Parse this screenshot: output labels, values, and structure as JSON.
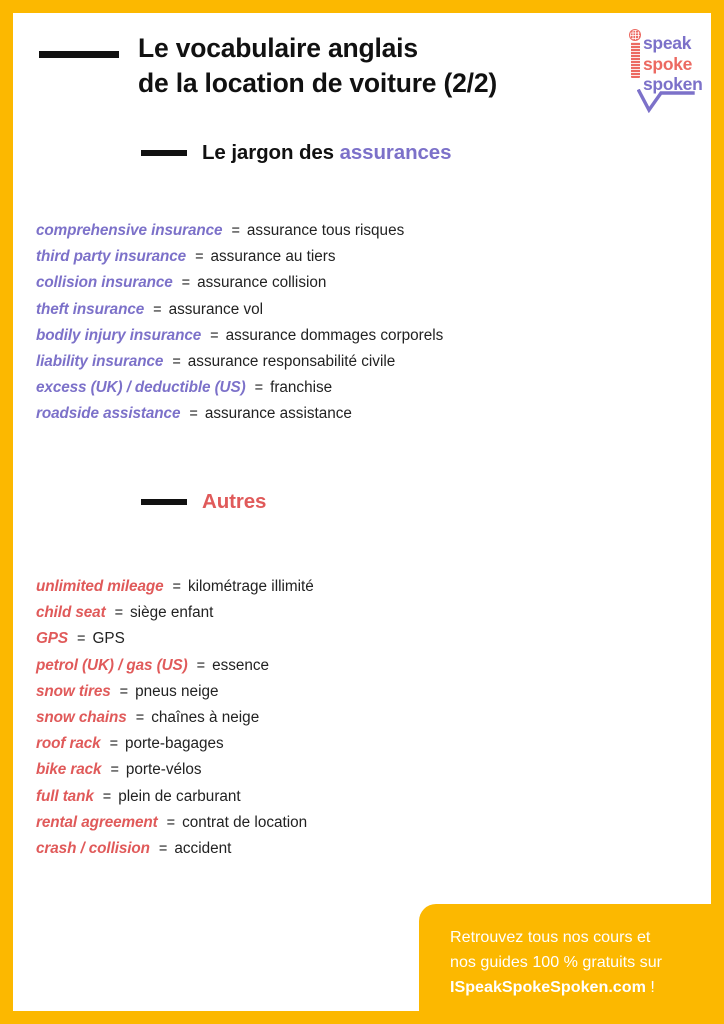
{
  "colors": {
    "frame": "#FCB800",
    "purple": "#7C71C9",
    "red": "#E05A5A",
    "black": "#111111",
    "white": "#FFFFFF"
  },
  "header": {
    "title_line1": "Le vocabulaire anglais",
    "title_line2": "de la location de voiture (2/2)"
  },
  "logo": {
    "word1": "speak",
    "word2": "spoke",
    "word3": "spoken",
    "i_letter": "i",
    "check": "check-swoosh"
  },
  "sections": [
    {
      "id": "assurances",
      "heading_plain": "Le jargon des ",
      "heading_accent": "assurances",
      "accent_color": "#7C71C9",
      "entries": [
        {
          "en": "comprehensive insurance",
          "eq": "=",
          "fr": "assurance tous risques"
        },
        {
          "en": "third party insurance",
          "eq": "=",
          "fr": "assurance au tiers"
        },
        {
          "en": "collision insurance",
          "eq": "=",
          "fr": "assurance collision"
        },
        {
          "en": "theft insurance",
          "eq": "=",
          "fr": "assurance vol"
        },
        {
          "en": "bodily injury insurance",
          "eq": "=",
          "fr": "assurance dommages corporels"
        },
        {
          "en": "liability insurance",
          "eq": "=",
          "fr": "assurance responsabilité civile"
        },
        {
          "en": "excess (UK) / deductible (US)",
          "eq": "=",
          "fr": "franchise"
        },
        {
          "en": "roadside assistance",
          "eq": "=",
          "fr": "assurance assistance"
        }
      ]
    },
    {
      "id": "autres",
      "heading_plain": "",
      "heading_accent": "Autres",
      "accent_color": "#E05A5A",
      "entries": [
        {
          "en": "unlimited mileage",
          "eq": "=",
          "fr": "kilométrage illimité"
        },
        {
          "en": "child seat",
          "eq": "=",
          "fr": "siège enfant"
        },
        {
          "en": "GPS",
          "eq": "=",
          "fr": "GPS"
        },
        {
          "en": "petrol (UK) / gas (US)",
          "eq": "=",
          "fr": "essence"
        },
        {
          "en": "snow tires",
          "eq": "=",
          "fr": "pneus neige"
        },
        {
          "en": "snow chains",
          "eq": "=",
          "fr": "chaînes à neige"
        },
        {
          "en": "roof rack",
          "eq": "=",
          "fr": "porte-bagages"
        },
        {
          "en": "bike rack",
          "eq": "=",
          "fr": "porte-vélos"
        },
        {
          "en": "full tank",
          "eq": "=",
          "fr": "plein de carburant"
        },
        {
          "en": "rental agreement",
          "eq": "=",
          "fr": "contrat de location"
        },
        {
          "en": "crash / collision",
          "eq": "=",
          "fr": "accident"
        }
      ]
    }
  ],
  "footer": {
    "line1": "Retrouvez tous nos cours et",
    "line2": "nos guides 100 % gratuits sur",
    "line3_strong": "ISpeakSpokeSpoken.com",
    "line3_tail": " !"
  }
}
